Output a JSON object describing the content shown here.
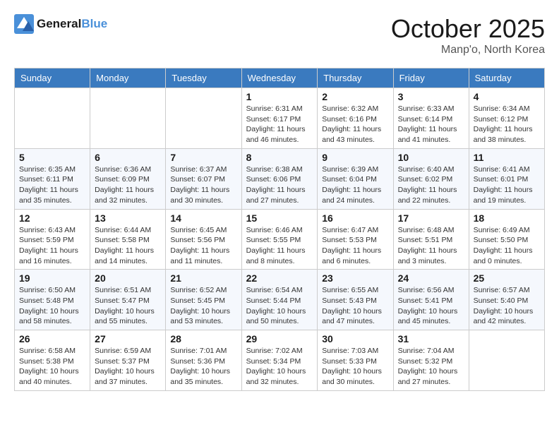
{
  "header": {
    "logo_line1": "General",
    "logo_line2": "Blue",
    "month": "October 2025",
    "location": "Manp'o, North Korea"
  },
  "weekdays": [
    "Sunday",
    "Monday",
    "Tuesday",
    "Wednesday",
    "Thursday",
    "Friday",
    "Saturday"
  ],
  "weeks": [
    [
      {
        "day": "",
        "info": ""
      },
      {
        "day": "",
        "info": ""
      },
      {
        "day": "",
        "info": ""
      },
      {
        "day": "1",
        "info": "Sunrise: 6:31 AM\nSunset: 6:17 PM\nDaylight: 11 hours\nand 46 minutes."
      },
      {
        "day": "2",
        "info": "Sunrise: 6:32 AM\nSunset: 6:16 PM\nDaylight: 11 hours\nand 43 minutes."
      },
      {
        "day": "3",
        "info": "Sunrise: 6:33 AM\nSunset: 6:14 PM\nDaylight: 11 hours\nand 41 minutes."
      },
      {
        "day": "4",
        "info": "Sunrise: 6:34 AM\nSunset: 6:12 PM\nDaylight: 11 hours\nand 38 minutes."
      }
    ],
    [
      {
        "day": "5",
        "info": "Sunrise: 6:35 AM\nSunset: 6:11 PM\nDaylight: 11 hours\nand 35 minutes."
      },
      {
        "day": "6",
        "info": "Sunrise: 6:36 AM\nSunset: 6:09 PM\nDaylight: 11 hours\nand 32 minutes."
      },
      {
        "day": "7",
        "info": "Sunrise: 6:37 AM\nSunset: 6:07 PM\nDaylight: 11 hours\nand 30 minutes."
      },
      {
        "day": "8",
        "info": "Sunrise: 6:38 AM\nSunset: 6:06 PM\nDaylight: 11 hours\nand 27 minutes."
      },
      {
        "day": "9",
        "info": "Sunrise: 6:39 AM\nSunset: 6:04 PM\nDaylight: 11 hours\nand 24 minutes."
      },
      {
        "day": "10",
        "info": "Sunrise: 6:40 AM\nSunset: 6:02 PM\nDaylight: 11 hours\nand 22 minutes."
      },
      {
        "day": "11",
        "info": "Sunrise: 6:41 AM\nSunset: 6:01 PM\nDaylight: 11 hours\nand 19 minutes."
      }
    ],
    [
      {
        "day": "12",
        "info": "Sunrise: 6:43 AM\nSunset: 5:59 PM\nDaylight: 11 hours\nand 16 minutes."
      },
      {
        "day": "13",
        "info": "Sunrise: 6:44 AM\nSunset: 5:58 PM\nDaylight: 11 hours\nand 14 minutes."
      },
      {
        "day": "14",
        "info": "Sunrise: 6:45 AM\nSunset: 5:56 PM\nDaylight: 11 hours\nand 11 minutes."
      },
      {
        "day": "15",
        "info": "Sunrise: 6:46 AM\nSunset: 5:55 PM\nDaylight: 11 hours\nand 8 minutes."
      },
      {
        "day": "16",
        "info": "Sunrise: 6:47 AM\nSunset: 5:53 PM\nDaylight: 11 hours\nand 6 minutes."
      },
      {
        "day": "17",
        "info": "Sunrise: 6:48 AM\nSunset: 5:51 PM\nDaylight: 11 hours\nand 3 minutes."
      },
      {
        "day": "18",
        "info": "Sunrise: 6:49 AM\nSunset: 5:50 PM\nDaylight: 11 hours\nand 0 minutes."
      }
    ],
    [
      {
        "day": "19",
        "info": "Sunrise: 6:50 AM\nSunset: 5:48 PM\nDaylight: 10 hours\nand 58 minutes."
      },
      {
        "day": "20",
        "info": "Sunrise: 6:51 AM\nSunset: 5:47 PM\nDaylight: 10 hours\nand 55 minutes."
      },
      {
        "day": "21",
        "info": "Sunrise: 6:52 AM\nSunset: 5:45 PM\nDaylight: 10 hours\nand 53 minutes."
      },
      {
        "day": "22",
        "info": "Sunrise: 6:54 AM\nSunset: 5:44 PM\nDaylight: 10 hours\nand 50 minutes."
      },
      {
        "day": "23",
        "info": "Sunrise: 6:55 AM\nSunset: 5:43 PM\nDaylight: 10 hours\nand 47 minutes."
      },
      {
        "day": "24",
        "info": "Sunrise: 6:56 AM\nSunset: 5:41 PM\nDaylight: 10 hours\nand 45 minutes."
      },
      {
        "day": "25",
        "info": "Sunrise: 6:57 AM\nSunset: 5:40 PM\nDaylight: 10 hours\nand 42 minutes."
      }
    ],
    [
      {
        "day": "26",
        "info": "Sunrise: 6:58 AM\nSunset: 5:38 PM\nDaylight: 10 hours\nand 40 minutes."
      },
      {
        "day": "27",
        "info": "Sunrise: 6:59 AM\nSunset: 5:37 PM\nDaylight: 10 hours\nand 37 minutes."
      },
      {
        "day": "28",
        "info": "Sunrise: 7:01 AM\nSunset: 5:36 PM\nDaylight: 10 hours\nand 35 minutes."
      },
      {
        "day": "29",
        "info": "Sunrise: 7:02 AM\nSunset: 5:34 PM\nDaylight: 10 hours\nand 32 minutes."
      },
      {
        "day": "30",
        "info": "Sunrise: 7:03 AM\nSunset: 5:33 PM\nDaylight: 10 hours\nand 30 minutes."
      },
      {
        "day": "31",
        "info": "Sunrise: 7:04 AM\nSunset: 5:32 PM\nDaylight: 10 hours\nand 27 minutes."
      },
      {
        "day": "",
        "info": ""
      }
    ]
  ]
}
